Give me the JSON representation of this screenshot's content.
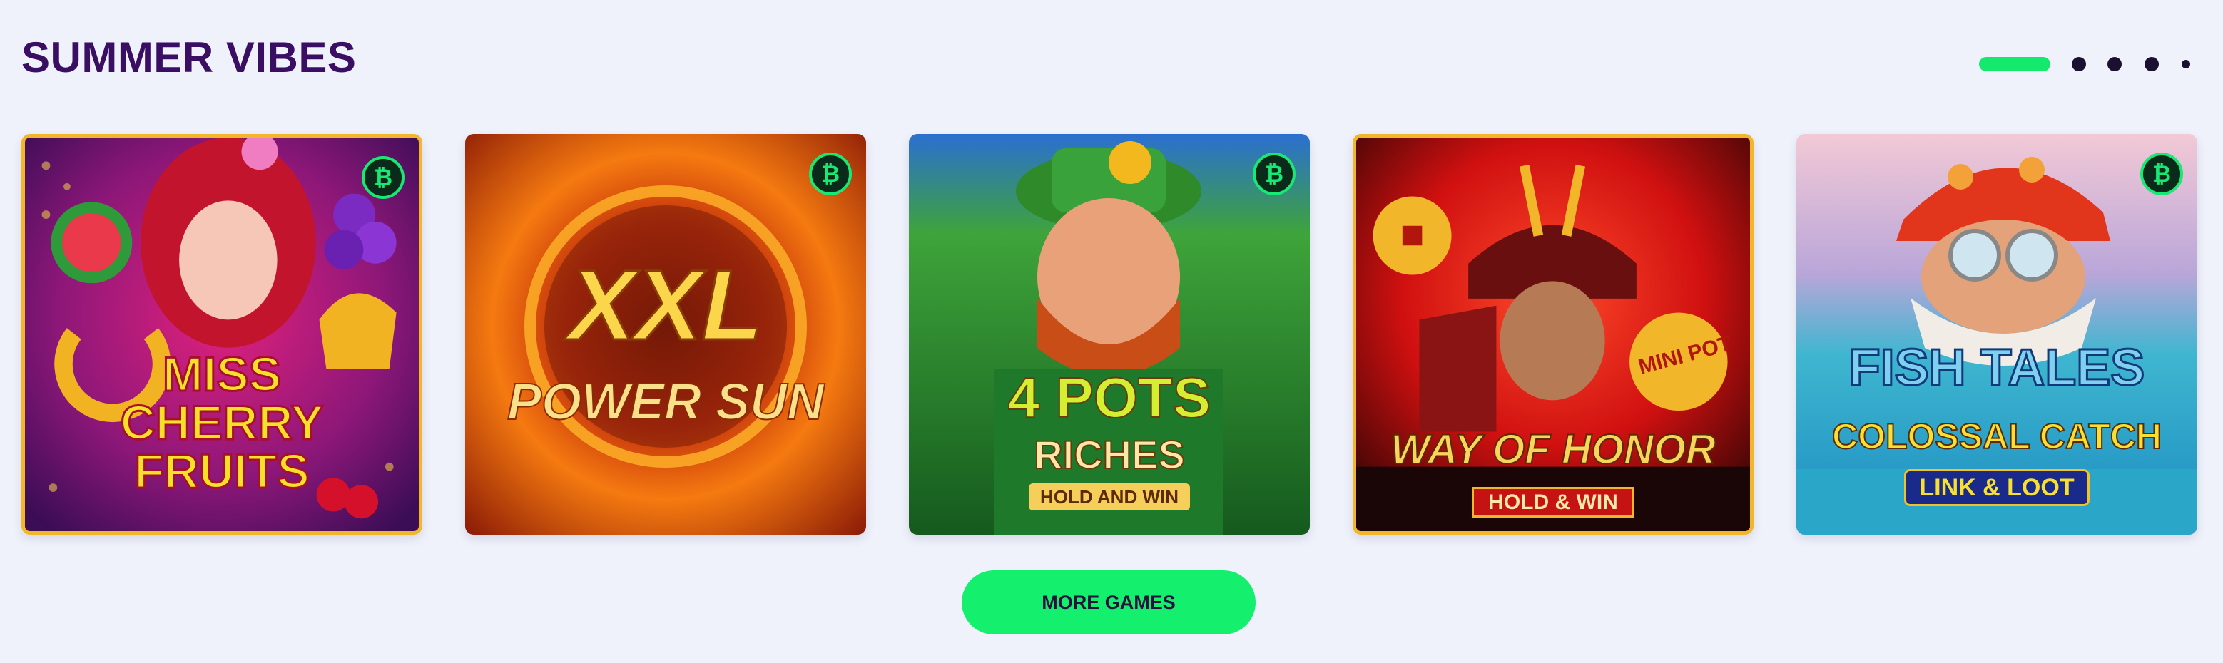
{
  "section": {
    "title": "SUMMER VIBES"
  },
  "pager": {
    "active_index": 0,
    "dot_count": 4
  },
  "games": [
    {
      "title_lines": [
        "MISS",
        "CHERRY",
        "FRUITS"
      ],
      "badge": "₿"
    },
    {
      "title_lines": [
        "XXL",
        "POWER SUN"
      ],
      "badge": "₿"
    },
    {
      "title_lines": [
        "4 POTS",
        "RICHES",
        "HOLD AND WIN"
      ],
      "badge": "₿"
    },
    {
      "title_lines": [
        "WAY OF HONOR",
        "HOLD & WIN",
        "MINI POT"
      ]
    },
    {
      "title_lines": [
        "FISH TALES",
        "COLOSSAL CATCH",
        "LINK & LOOT"
      ],
      "badge": "₿"
    }
  ],
  "actions": {
    "more_games": "MORE GAMES"
  },
  "colors": {
    "accent": "#14ef6e",
    "title": "#3a0f63",
    "background": "#eff2fb"
  }
}
